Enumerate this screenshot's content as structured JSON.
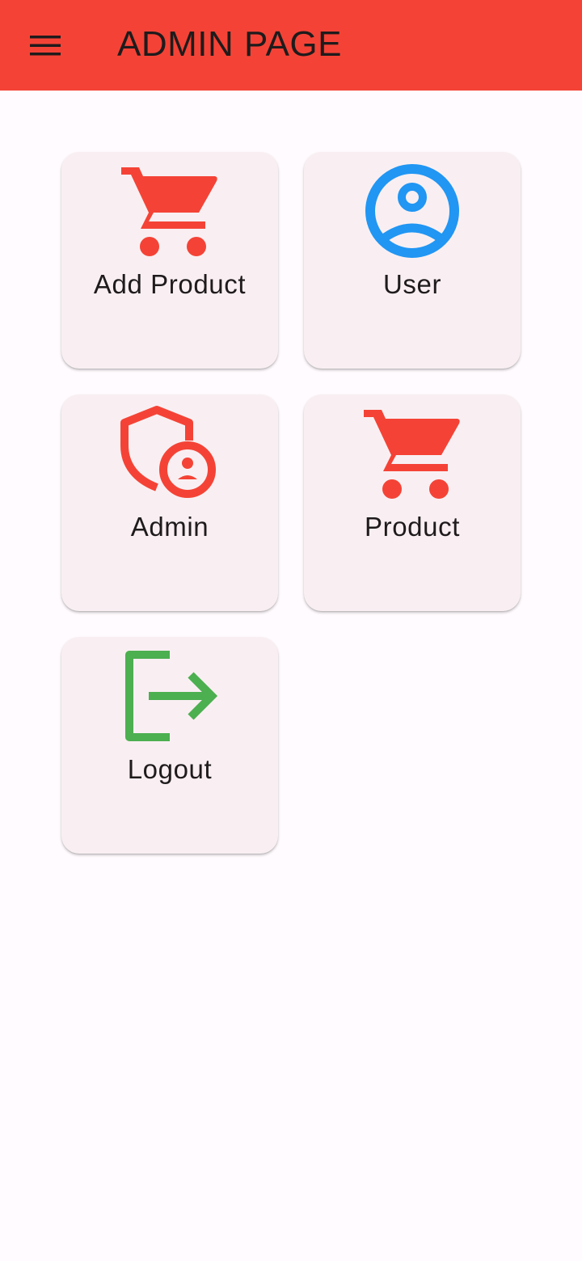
{
  "appbar": {
    "title": "ADMIN PAGE",
    "menu_icon": "menu-icon",
    "background_color": "#f44336"
  },
  "tiles": [
    {
      "label": "Add Product",
      "icon": "shopping-cart-icon",
      "icon_color": "#f44336"
    },
    {
      "label": "User",
      "icon": "account-circle-icon",
      "icon_color": "#2196f3"
    },
    {
      "label": "Admin",
      "icon": "admin-shield-icon",
      "icon_color": "#f44336"
    },
    {
      "label": "Product",
      "icon": "shopping-cart-icon",
      "icon_color": "#f44336"
    },
    {
      "label": "Logout",
      "icon": "logout-icon",
      "icon_color": "#4caf50"
    }
  ]
}
